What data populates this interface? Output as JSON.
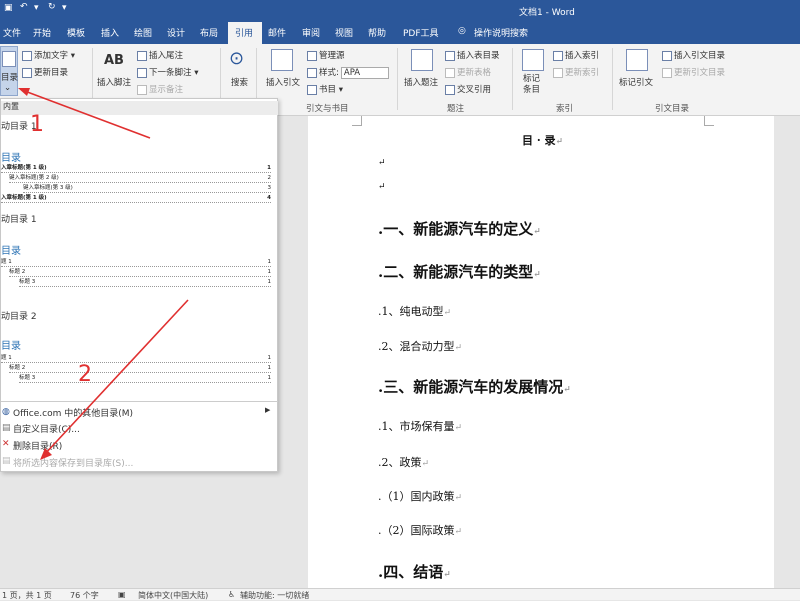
{
  "titlebar": {
    "title": "文档1 - Word"
  },
  "tabs": [
    "文件",
    "开始",
    "模板",
    "插入",
    "绘图",
    "设计",
    "布局",
    "引用",
    "邮件",
    "审阅",
    "视图",
    "帮助",
    "PDF工具",
    "操作说明搜索"
  ],
  "ribbon": {
    "toc_button": "目录",
    "add_text": "添加文字",
    "update_toc": "更新目录",
    "insert_footnote": "插入脚注",
    "ab_label": "AB",
    "insert_endnote": "插入尾注",
    "next_footnote": "下一条脚注",
    "show_notes": "显示备注",
    "search": "搜索",
    "insert_citation": "插入引文",
    "manage_sources": "管理源",
    "style_label": "样式:",
    "style_value": "APA",
    "bibliography": "书目",
    "group_citations": "引文与书目",
    "insert_caption": "插入题注",
    "insert_table_of_figures": "插入表目录",
    "update_table": "更新表格",
    "cross_reference": "交叉引用",
    "group_captions": "题注",
    "mark_entry": "标记条目",
    "insert_index": "插入索引",
    "update_index": "更新索引",
    "group_index": "索引",
    "mark_citation": "标记引文",
    "insert_toa": "插入引文目录",
    "update_toa": "更新引文目录",
    "group_toa": "引文目录"
  },
  "dropdown": {
    "builtin": "内置",
    "auto1": "动目录 1",
    "toc_heading": "目录",
    "sample1": [
      [
        "入章标题(第 1 级)",
        "1"
      ],
      [
        "键入章标题(第 2 级)",
        "2"
      ],
      [
        "键入章标题(第 3 级)",
        "3"
      ],
      [
        "入章标题(第 1 级)",
        "4"
      ]
    ],
    "auto_toc1": "动目录 1",
    "sample2": [
      [
        "题 1",
        "1"
      ],
      [
        "标题 2",
        "1"
      ],
      [
        "标题 3",
        "1"
      ]
    ],
    "auto_toc2": "动目录 2",
    "sample3": [
      [
        "题 1",
        "1"
      ],
      [
        "标题 2",
        "1"
      ],
      [
        "标题 3",
        "1"
      ]
    ],
    "more_office": "Office.com 中的其他目录(M)",
    "custom_toc": "自定义目录(C)...",
    "remove_toc": "删除目录(R)",
    "save_selection": "将所选内容保存到目录库(S)..."
  },
  "document": {
    "title": "目 · 录",
    "lines": [
      {
        "text": ".一、新能源汽车的定义",
        "style": "h"
      },
      {
        "text": ".二、新能源汽车的类型",
        "style": "h"
      },
      {
        "text": ".1、纯电动型",
        "style": "n"
      },
      {
        "text": ".2、混合动力型",
        "style": "n"
      },
      {
        "text": ".三、新能源汽车的发展情况",
        "style": "h"
      },
      {
        "text": ".1、市场保有量",
        "style": "n"
      },
      {
        "text": ".2、政策",
        "style": "n"
      },
      {
        "text": ".（1）国内政策",
        "style": "n"
      },
      {
        "text": ".（2）国际政策",
        "style": "n"
      },
      {
        "text": ".四、结语",
        "style": "h"
      }
    ]
  },
  "annotations": {
    "one": "1",
    "two": "2"
  },
  "statusbar": {
    "page": "1 页，共 1 页",
    "words": "76 个字",
    "lang": "简体中文(中国大陆)",
    "access": "辅助功能: 一切就绪"
  },
  "colors": {
    "accent": "#2b579a",
    "arrow": "#e03030"
  }
}
